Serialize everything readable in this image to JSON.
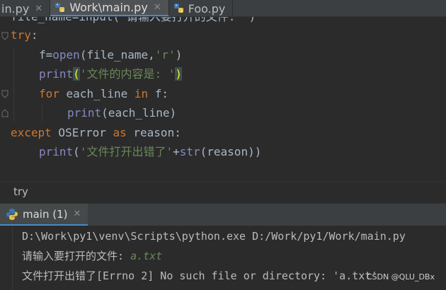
{
  "tabs": [
    {
      "label": "in.py",
      "active": false
    },
    {
      "label": "Work\\main.py",
      "active": true
    },
    {
      "label": "Foo.py",
      "active": false
    }
  ],
  "editor": {
    "partial_top": "file_name=input('请输入要打开的文件: ')",
    "line_try": "try",
    "line_open_var": "f",
    "line_open_fn": "open",
    "line_open_args": "(file_name,",
    "line_open_str": "'r'",
    "line_open_close": ")",
    "line_print1_fn": "print",
    "line_print1_str": "'文件的内容是: '",
    "line_for_kw": "for",
    "line_for_var": " each_line ",
    "line_for_in": "in",
    "line_for_rest": " f:",
    "line_print2_fn": "print",
    "line_print2_args": "(each_line)",
    "line_except_kw": "except",
    "line_except_cls": " OSError ",
    "line_except_as": "as",
    "line_except_rest": " reason:",
    "line_print3_fn": "print",
    "line_print3_str": "'文件打开出错了'",
    "line_print3_plus": "+",
    "line_print3_str_fn": "str",
    "line_print3_args": "(reason))"
  },
  "breadcrumb": "try",
  "run": {
    "tab_label": "main (1)",
    "cmd": "D:\\Work\\py1\\venv\\Scripts\\python.exe D:/Work/py1/Work/main.py",
    "prompt": "请输入要打开的文件: ",
    "input": "a.txt",
    "error": "文件打开出错了[Errno 2] No such file or directory: 'a.txt'"
  },
  "watermark": "CSDN @QLU_DBx",
  "colors": {
    "keyword": "#cc7832",
    "builtin": "#8888c6",
    "string": "#6a8759",
    "accent": "#4a88c7"
  }
}
